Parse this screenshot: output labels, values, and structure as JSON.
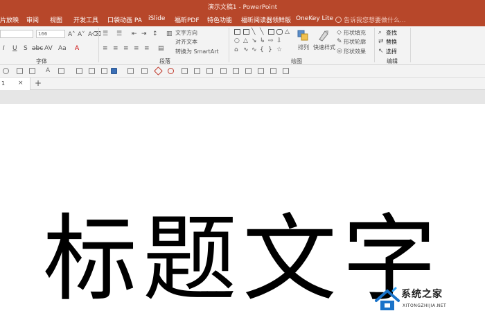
{
  "window": {
    "title": "演示文稿1 - PowerPoint"
  },
  "tabs": [
    "片放映",
    "审阅",
    "视图",
    "开发工具",
    "口袋动画 PA",
    "iSlide",
    "福昕PDF",
    "特色功能",
    "福昕阅读器领鲜版",
    "OneKey Lite"
  ],
  "tell_me": "告诉我您想要做什么...",
  "ribbon": {
    "font_size": "166",
    "font_group_label": "字体",
    "paragraph_group_label": "段落",
    "drawing_group_label": "绘图",
    "editing_group_label": "编辑",
    "text_direction": "文字方向",
    "align_text": "对齐文本",
    "convert_smartart": "转换为 SmartArt",
    "arrange": "排列",
    "quick_styles": "快速样式",
    "shape_fill": "形状填充",
    "shape_outline": "形状轮廓",
    "shape_effects": "形状效果",
    "find": "查找",
    "replace": "替换",
    "select": "选择"
  },
  "doc_tab": {
    "label": "1"
  },
  "slide": {
    "title": "标题文字"
  },
  "watermark": {
    "name": "系统之家",
    "url": "XITONGZHIJIA.NET"
  }
}
